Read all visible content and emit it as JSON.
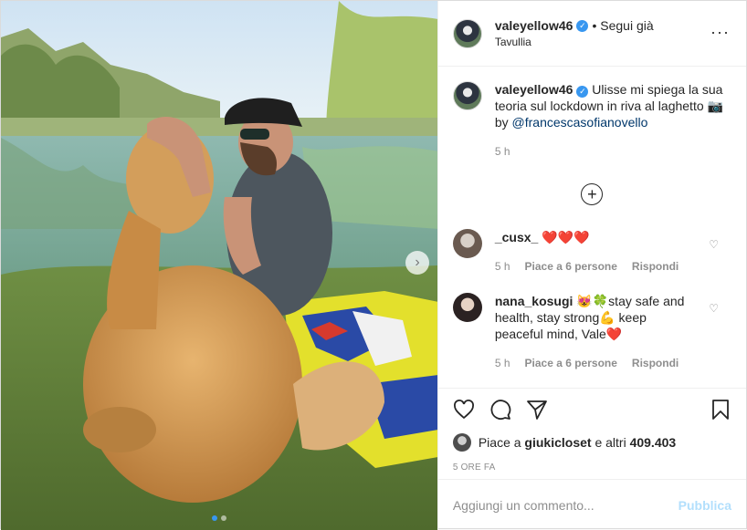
{
  "post": {
    "username": "valeyellow46",
    "follow_label": "• Segui già",
    "location": "Tavullia",
    "more_icon": "more-horizontal-icon"
  },
  "caption": {
    "username": "valeyellow46",
    "text": "Ulisse mi spiega la sua teoria sul lockdown in riva al laghetto",
    "camera_emoji": "📷",
    "by": "by",
    "credit": "@francescasofianovello",
    "time": "5 h"
  },
  "comments": [
    {
      "username": "_cusx_",
      "text": "❤️❤️❤️",
      "time": "5 h",
      "likes": "Piace a 6 persone",
      "reply": "Rispondi"
    },
    {
      "username": "nana_kosugi",
      "text": "😻🍀stay safe and health, stay strong💪 keep peaceful mind, Vale❤️",
      "time": "5 h",
      "likes": "Piace a 6 persone",
      "reply": "Rispondi"
    }
  ],
  "likes": {
    "prefix": "Piace a",
    "user": "giukicloset",
    "and": "e altri",
    "count": "409.403"
  },
  "time_ago": "5 ORE FA",
  "add_comment": {
    "placeholder": "Aggiungi un commento...",
    "publish": "Pubblica"
  },
  "colors": {
    "accent": "#3897f0",
    "publish_disabled": "#b2dffc",
    "heart_red": "#ed4956"
  }
}
